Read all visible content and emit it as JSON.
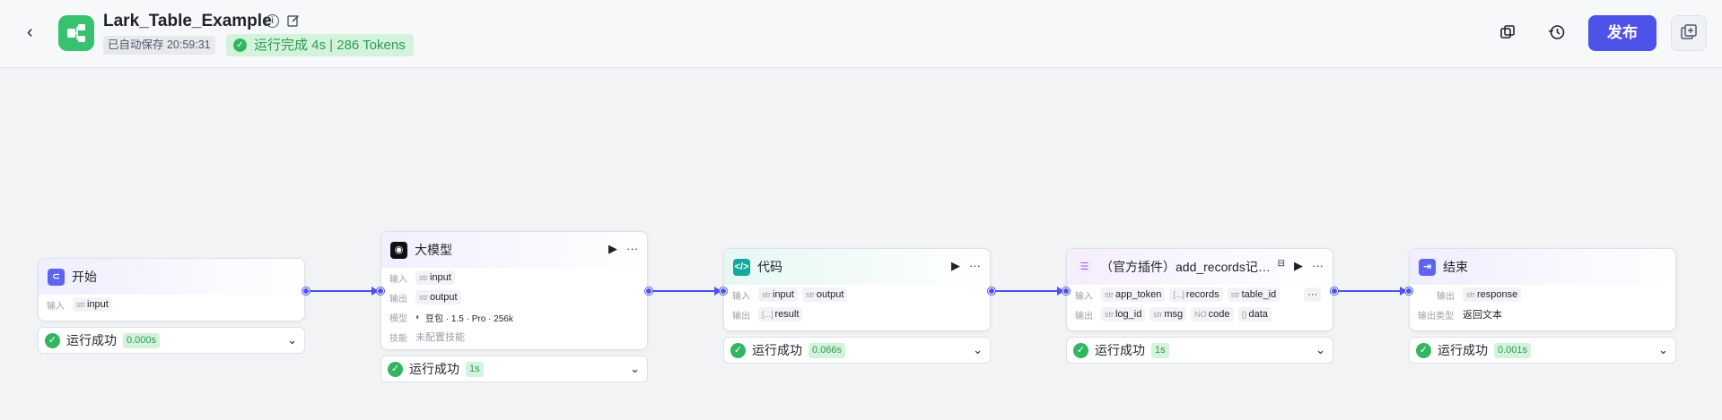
{
  "header": {
    "title": "Lark_Table_Example",
    "autosave": "已自动保存 20:59:31",
    "run_status": "运行完成 4s | 286 Tokens",
    "publish_label": "发布"
  },
  "nodes": {
    "start": {
      "name": "开始",
      "input_label": "输入",
      "input_type": "str",
      "input_name": "input",
      "result": "运行成功",
      "time": "0.000s"
    },
    "llm": {
      "name": "大模型",
      "input_label": "输入",
      "input_type": "str",
      "input_name": "input",
      "output_label": "输出",
      "output_type": "str",
      "output_name": "output",
      "model_label": "模型",
      "model_value": "豆包 · 1.5 · Pro · 256k",
      "skill_label": "技能",
      "skill_value": "未配置技能",
      "result": "运行成功",
      "time": "1s"
    },
    "code": {
      "name": "代码",
      "input_label": "输入",
      "input_type_1": "str",
      "input_name_1": "input",
      "input_type_2": "str",
      "input_name_2": "output",
      "output_label": "输出",
      "output_type": "[...]",
      "output_name": "result",
      "result": "运行成功",
      "time": "0.066s"
    },
    "plugin": {
      "name": "（官方插件）add_records记…",
      "input_label": "输入",
      "input_type_1": "str",
      "input_name_1": "app_token",
      "input_type_2": "[...]",
      "input_name_2": "records",
      "input_type_3": "str",
      "input_name_3": "table_id",
      "more": "···",
      "output_label": "输出",
      "output_type_1": "str",
      "output_name_1": "log_id",
      "output_type_2": "str",
      "output_name_2": "msg",
      "output_type_3": "NO",
      "output_name_3": "code",
      "output_type_4": "{}",
      "output_name_4": "data",
      "result": "运行成功",
      "time": "1s"
    },
    "end": {
      "name": "结束",
      "output_label": "输出",
      "output_type": "str",
      "output_name": "response",
      "output_kind_label": "输出类型",
      "output_kind_value": "返回文本",
      "result": "运行成功",
      "time": "0.001s"
    }
  }
}
